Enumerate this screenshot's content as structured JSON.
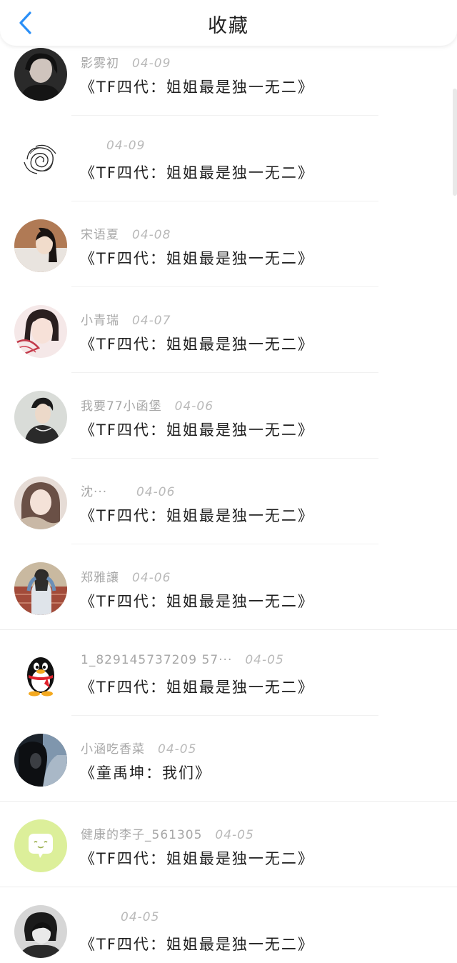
{
  "header": {
    "title": "收藏",
    "back_icon": "chevron-left-icon",
    "accent_color": "#2a8ff7"
  },
  "items": [
    {
      "author": "影雾初",
      "date": "04-09",
      "title": "《TF四代：姐姐最是独一无二》",
      "avatar": "photo-dark-portrait"
    },
    {
      "author": "",
      "date": "04-09",
      "title": "《TF四代：姐姐最是独一无二》",
      "avatar": "scribble-drawing"
    },
    {
      "author": "宋语夏",
      "date": "04-08",
      "title": "《TF四代：姐姐最是独一无二》",
      "avatar": "photo-girl-portrait"
    },
    {
      "author": "小青瑞",
      "date": "04-07",
      "title": "《TF四代：姐姐最是独一无二》",
      "avatar": "photo-girl-pink"
    },
    {
      "author": "我要77小函堡",
      "date": "04-06",
      "title": "《TF四代：姐姐最是独一无二》",
      "avatar": "photo-boy-portrait"
    },
    {
      "author": "沈···",
      "date": "04-06",
      "title": "《TF四代：姐姐最是独一无二》",
      "avatar": "photo-girl-scarf"
    },
    {
      "author": "郑雅讓",
      "date": "04-06",
      "title": "《TF四代：姐姐最是独一无二》",
      "avatar": "photo-girl-brick"
    },
    {
      "author": "1_829145737209 57···",
      "date": "04-05",
      "title": "《TF四代：姐姐最是独一无二》",
      "avatar": "qq-penguin-icon"
    },
    {
      "author": "小涵吃香菜",
      "date": "04-05",
      "title": "《童禹坤：我们》",
      "avatar": "photo-dark-sky"
    },
    {
      "author": "健康的李子_561305",
      "date": "04-05",
      "title": "《TF四代：姐姐最是独一无二》",
      "avatar": "chat-bubble-icon"
    },
    {
      "author": "",
      "date": "04-05",
      "title": "《TF四代：姐姐最是独一无二》",
      "avatar": "photo-bw-portrait"
    }
  ]
}
